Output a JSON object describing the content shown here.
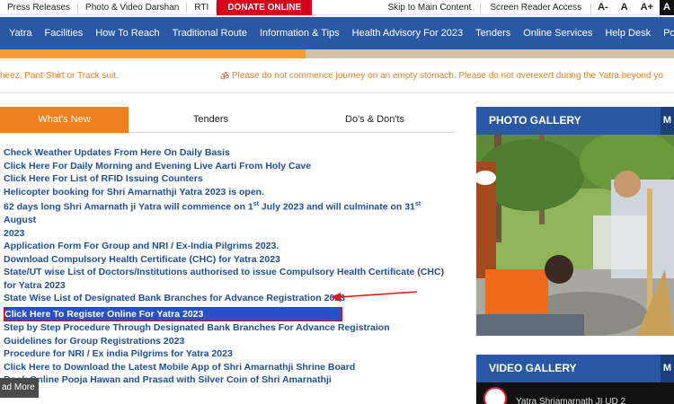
{
  "topbar": {
    "links": [
      "Press Releases",
      "Photo & Video Darshan",
      "RTI"
    ],
    "donate": "DONATE ONLINE",
    "skip": "Skip to Main Content",
    "screen_reader": "Screen Reader Access",
    "font_minus": "A-",
    "font_normal": "A",
    "font_plus": "A+",
    "font_contrast": "A"
  },
  "nav": {
    "items": [
      "Yatra",
      "Facilities",
      "How To Reach",
      "Traditional Route",
      "Information & Tips",
      "Health Advisory For 2023",
      "Tenders",
      "Online Services",
      "Help Desk",
      "Policies"
    ]
  },
  "ticker": {
    "text1": "heez, Pant-Shirt or Track suit.",
    "om": "ॐ",
    "text2": "Please do not commence journey on an empty stomach. Please do not overexert during the Yatra beyond yo"
  },
  "tabs": [
    "What's New",
    "Tenders",
    "Do's & Don'ts"
  ],
  "news": [
    {
      "text": "Check Weather Updates From Here On Daily Basis"
    },
    {
      "text": "Click Here For Daily Morning and Evening Live Aarti From Holy Cave"
    },
    {
      "text": "Click Here For List of RFID Issuing Counters"
    },
    {
      "text": "Helicopter booking for Shri Amarnathji Yatra 2023 is open."
    },
    {
      "a": "62 days long Shri Amarnath ji Yatra will commence on 1",
      "sup1": "st",
      "b": " July 2023 and will culminate on 31",
      "sup2": "st",
      "c": " August",
      "d": "2023"
    },
    {
      "text": "Application Form For Group and NRI / Ex-India Pilgrims 2023."
    },
    {
      "text": "Download Compulsory Health Certificate (CHC) for Yatra 2023"
    },
    {
      "text": "State/UT wise List of Doctors/Institutions authorised to issue Compulsory Health Certificate (CHC)",
      "line2": "for Yatra 2023"
    },
    {
      "text": "State Wise List of Designated Bank Branches for Advance Registration 2023"
    },
    {
      "text": "Click Here To Register Online For Yatra 2023"
    },
    {
      "text": "Step by Step Procedure Through Designated Bank Branches For Advance Registraion"
    },
    {
      "text": "Guidelines for Group Registrations 2023"
    },
    {
      "text": "Procedure for NRI / Ex india Pilgrims for Yatra 2023"
    },
    {
      "text": "Click Here to Download the Latest Mobile App of Shri Amarnathji Shrine Board"
    },
    {
      "text": "Book Online Pooja Hawan and Prasad with Silver Coin of Shri Amarnathji"
    }
  ],
  "read_more": "ad More",
  "photo_gallery": {
    "title": "PHOTO GALLERY",
    "cut": "M"
  },
  "video_gallery": {
    "title": "VIDEO GALLERY",
    "cut": "M",
    "caption": "Yatra Shriamarnath JI UD 2"
  },
  "colors": {
    "nav": "#2b58a5",
    "accent": "#f07f1f",
    "link": "#1f4e9c",
    "donate": "#d6001c"
  }
}
